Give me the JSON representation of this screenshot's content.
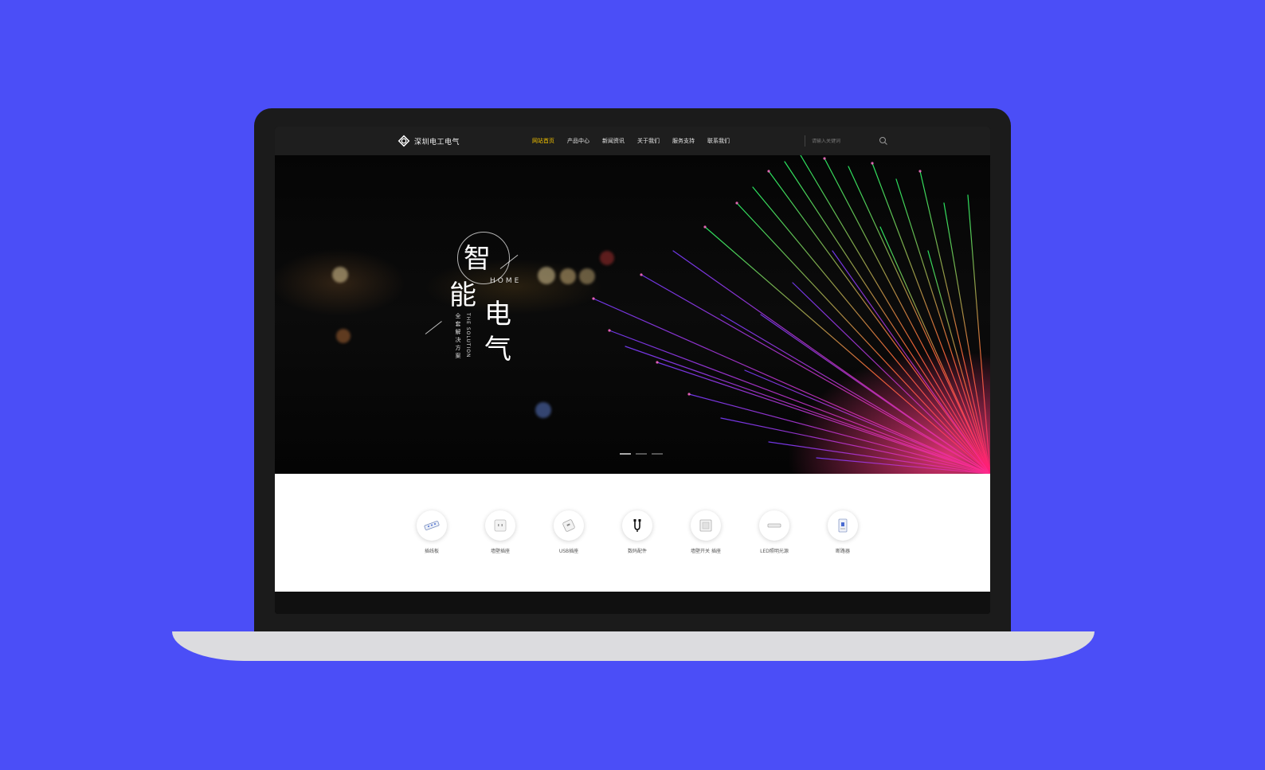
{
  "colors": {
    "background": "#4b4ef7",
    "accent_active_nav": "#f2c200",
    "laptop": "#1b1b1b",
    "laptop_base": "#dcdcdf"
  },
  "site": {
    "logo_text": "深圳电工电气",
    "nav": [
      {
        "label": "网站首页",
        "active": true
      },
      {
        "label": "产品中心",
        "active": false
      },
      {
        "label": "新闻资讯",
        "active": false
      },
      {
        "label": "关于我们",
        "active": false
      },
      {
        "label": "服务支持",
        "active": false
      },
      {
        "label": "联系我们",
        "active": false
      }
    ],
    "search": {
      "placeholder": "请输入关键词",
      "icon": "search-icon"
    }
  },
  "hero": {
    "char_1": "智",
    "char_2": "能",
    "char_3": "电",
    "char_4": "气",
    "home": "HOME",
    "vertical_en": "THE SOLUTION",
    "vertical_cn": "全套解决方案",
    "slides": 3,
    "active_slide": 1
  },
  "categories": [
    {
      "label": "插线板",
      "icon": "power-strip-icon"
    },
    {
      "label": "墙壁插座",
      "icon": "wall-socket-icon"
    },
    {
      "label": "USB插座",
      "icon": "usb-socket-icon"
    },
    {
      "label": "数码配件",
      "icon": "digital-accessory-icon"
    },
    {
      "label": "墙壁开关 插座",
      "icon": "wall-switch-icon"
    },
    {
      "label": "LED照明光源",
      "icon": "led-light-icon"
    },
    {
      "label": "断路器",
      "icon": "circuit-breaker-icon"
    }
  ]
}
